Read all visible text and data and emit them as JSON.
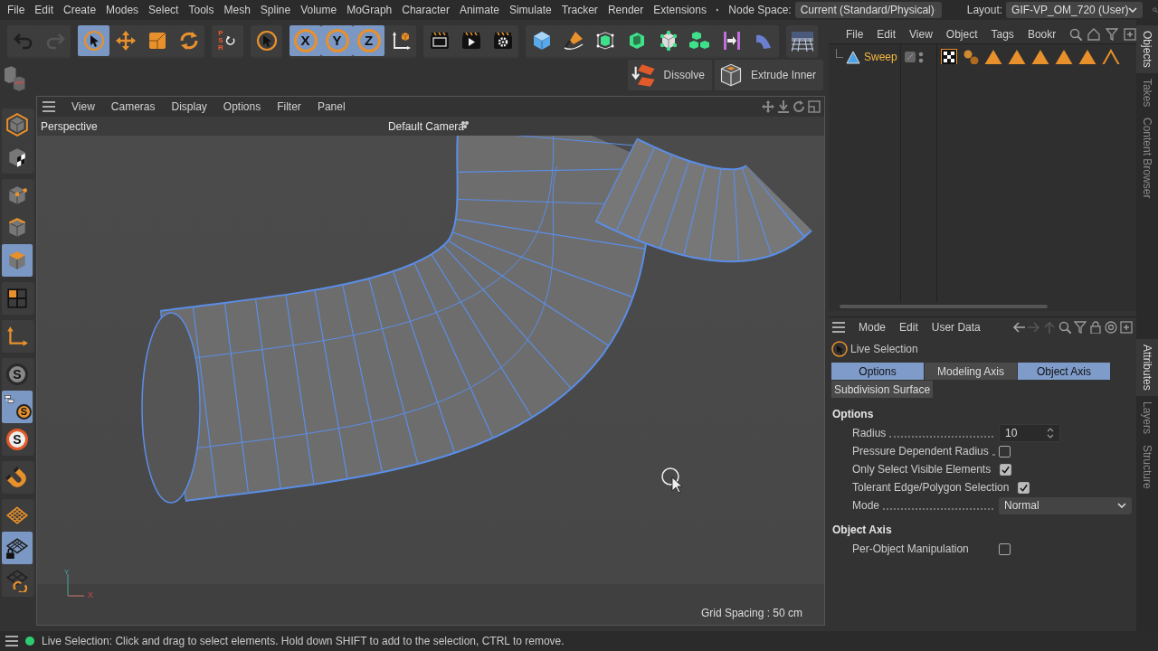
{
  "menu": [
    "File",
    "Edit",
    "Create",
    "Modes",
    "Select",
    "Tools",
    "Mesh",
    "Spline",
    "Volume",
    "MoGraph",
    "Character",
    "Animate",
    "Simulate",
    "Tracker",
    "Render",
    "Extensions"
  ],
  "node_space": {
    "label": "Node Space:",
    "value": "Current (Standard/Physical)"
  },
  "layout": {
    "label": "Layout:",
    "value": "GIF-VP_OM_720 (User)"
  },
  "toolbar": [
    {
      "items": [
        {
          "kind": "undo",
          "selected": false
        },
        {
          "kind": "redo",
          "selected": false
        }
      ]
    },
    {
      "items": [
        {
          "kind": "live-select",
          "selected": true
        },
        {
          "kind": "move",
          "selected": false
        },
        {
          "kind": "scale",
          "selected": false
        },
        {
          "kind": "rotate",
          "selected": false
        }
      ]
    },
    {
      "items": [
        {
          "kind": "psr",
          "selected": false,
          "letters": [
            "P",
            "S",
            "R"
          ]
        }
      ]
    },
    {
      "items": [
        {
          "kind": "select-tool",
          "selected": false
        }
      ]
    },
    {
      "items": [
        {
          "kind": "axis-letter",
          "selected": true,
          "label": "X"
        },
        {
          "kind": "axis-letter",
          "selected": true,
          "label": "Y"
        },
        {
          "kind": "axis-letter",
          "selected": true,
          "label": "Z"
        },
        {
          "kind": "coord",
          "selected": false
        }
      ]
    },
    {
      "items": [
        {
          "kind": "render-view",
          "selected": false
        },
        {
          "kind": "render",
          "selected": false
        },
        {
          "kind": "render-settings",
          "selected": false
        }
      ]
    },
    {
      "items": [
        {
          "kind": "cube",
          "selected": false
        },
        {
          "kind": "pen",
          "selected": false
        },
        {
          "kind": "subdiv",
          "selected": false
        },
        {
          "kind": "extrude",
          "selected": false
        },
        {
          "kind": "vertex",
          "selected": false
        },
        {
          "kind": "cubes",
          "selected": false
        },
        {
          "kind": "symmetry",
          "selected": false
        },
        {
          "kind": "bend",
          "selected": false
        }
      ]
    },
    {
      "items": [
        {
          "kind": "floor",
          "selected": false
        }
      ]
    }
  ],
  "commands": [
    {
      "kind": "dissolve",
      "label": "Dissolve"
    },
    {
      "kind": "extrude-inner",
      "label": "Extrude Inner"
    }
  ],
  "left_toolbar": [
    {
      "items": [
        {
          "kind": "model",
          "selected": false
        },
        {
          "kind": "texture",
          "selected": false
        }
      ]
    },
    {
      "items": [
        {
          "kind": "points",
          "selected": false
        },
        {
          "kind": "edges",
          "selected": false
        },
        {
          "kind": "polygons",
          "selected": true
        }
      ]
    },
    {
      "items": [
        {
          "kind": "uv",
          "selected": false
        }
      ]
    },
    {
      "items": [
        {
          "kind": "axis",
          "selected": false
        }
      ]
    },
    {
      "items": [
        {
          "kind": "snap",
          "selected": false,
          "label": "S"
        },
        {
          "kind": "snap-tree",
          "selected": true,
          "label": "S"
        },
        {
          "kind": "snap-circle",
          "selected": false,
          "label": "S"
        }
      ]
    },
    {
      "items": [
        {
          "kind": "magnet",
          "selected": false
        }
      ]
    },
    {
      "items": [
        {
          "kind": "grid",
          "selected": false
        },
        {
          "kind": "grid-lock",
          "selected": true
        },
        {
          "kind": "grid-rotate",
          "selected": false
        }
      ]
    }
  ],
  "viewport": {
    "menu": [
      "View",
      "Cameras",
      "Display",
      "Options",
      "Filter",
      "Panel"
    ],
    "view_name": "Perspective",
    "camera": "Default Camera",
    "grid_spacing": "Grid Spacing : 50 cm",
    "axis_y": "Y",
    "axis_x": "X"
  },
  "objects": {
    "menu": [
      "File",
      "Edit",
      "View",
      "Object",
      "Tags",
      "Bookr"
    ],
    "items": [
      {
        "name": "Sweep",
        "selected": true
      }
    ]
  },
  "attributes": {
    "menu": [
      "Mode",
      "Edit",
      "User Data"
    ],
    "tool": "Live Selection",
    "tabs": [
      {
        "label": "Options",
        "selected": true
      },
      {
        "label": "Modeling Axis",
        "selected": false
      },
      {
        "label": "Object Axis",
        "selected": true
      },
      {
        "label": "Subdivision Surface",
        "selected": false
      }
    ],
    "sections": [
      {
        "title": "Options",
        "fields": [
          {
            "kind": "number",
            "label": "Radius",
            "value": "10"
          },
          {
            "kind": "checkbox",
            "label": "Pressure Dependent Radius",
            "checked": false
          },
          {
            "kind": "checkbox",
            "label": "Only Select Visible Elements",
            "checked": true
          },
          {
            "kind": "checkbox",
            "label": "Tolerant Edge/Polygon Selection",
            "checked": true
          },
          {
            "kind": "dropdown",
            "label": "Mode",
            "value": "Normal"
          }
        ]
      },
      {
        "title": "Object Axis",
        "fields": [
          {
            "kind": "checkbox",
            "label": "Per-Object Manipulation",
            "checked": false
          }
        ]
      }
    ]
  },
  "side_tabs_top": [
    {
      "label": "Objects",
      "selected": true
    },
    {
      "label": "Takes",
      "selected": false
    },
    {
      "label": "Content Browser",
      "selected": false
    }
  ],
  "side_tabs_bottom": [
    {
      "label": "Attributes",
      "selected": true
    },
    {
      "label": "Layers",
      "selected": false
    },
    {
      "label": "Structure",
      "selected": false
    }
  ],
  "status": {
    "color": "#2ecc71",
    "text": "Live Selection: Click and drag to select elements. Hold down SHIFT to add to the selection, CTRL to remove."
  }
}
